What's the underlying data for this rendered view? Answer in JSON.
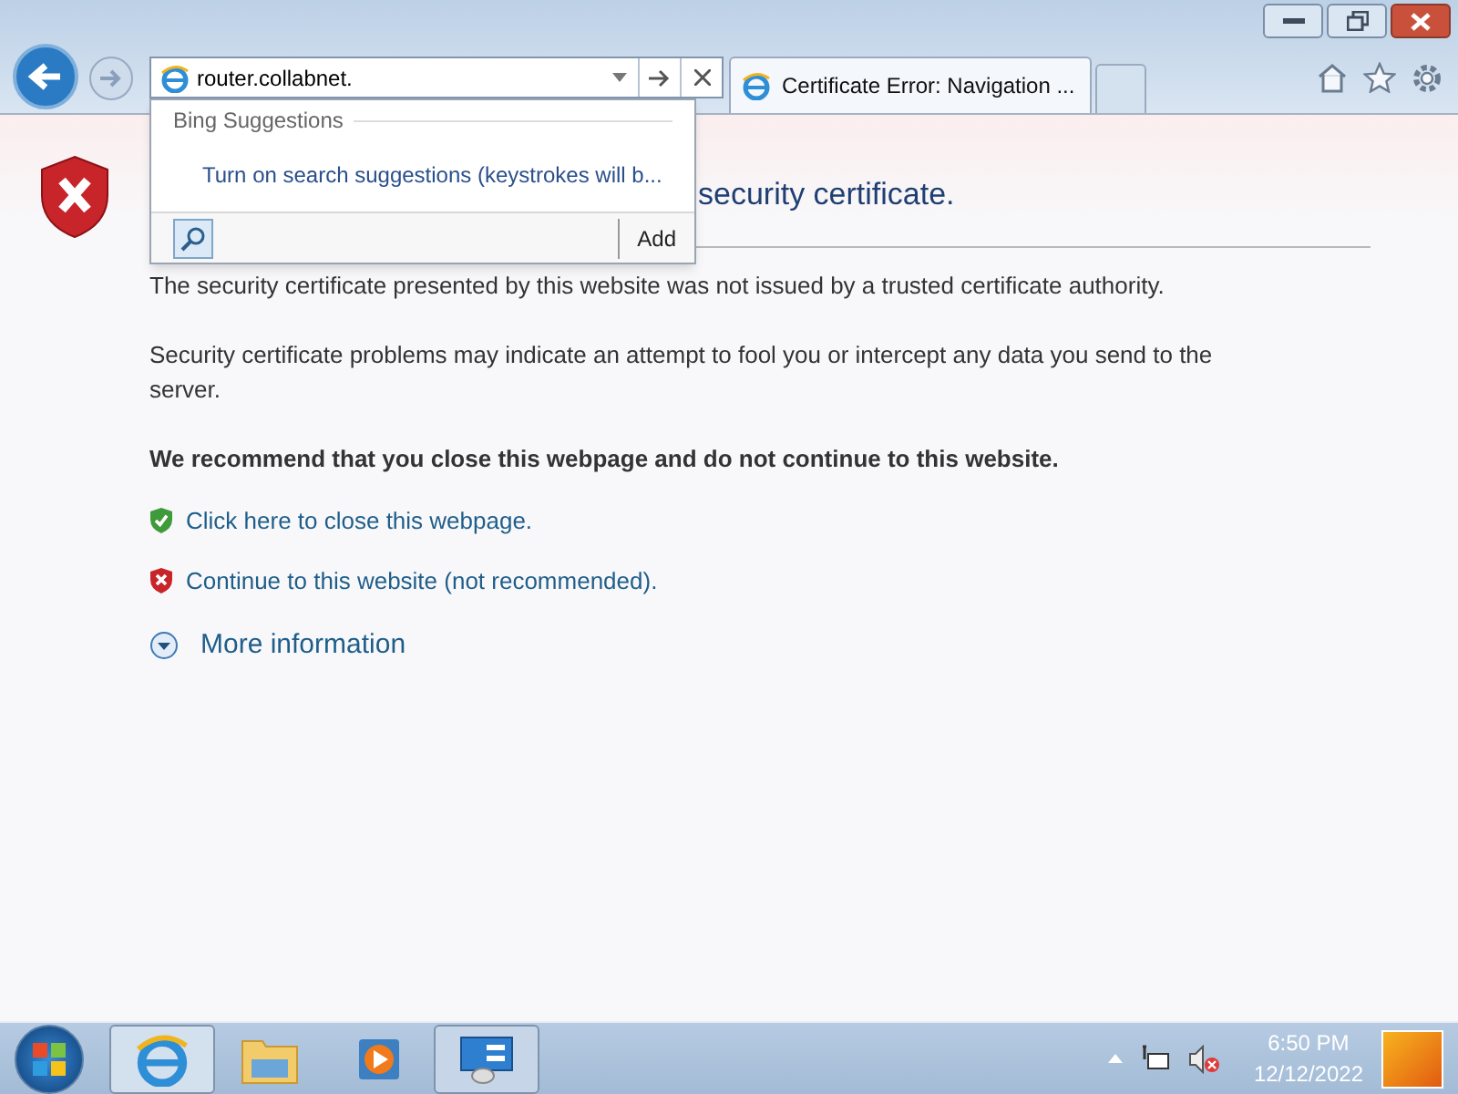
{
  "address_bar": {
    "value": "router.collabnet."
  },
  "tabs": [
    {
      "label": "Certificate Error: Navigation ...",
      "selected": true
    }
  ],
  "suggestions": {
    "header": "Bing Suggestions",
    "item": "Turn on search suggestions (keystrokes will b...",
    "add_label": "Add"
  },
  "page": {
    "heading": "security certificate.",
    "paragraphs": [
      "The security certificate presented by this website was not issued by a trusted certificate authority.",
      "Security certificate problems may indicate an attempt to fool you or intercept any data you send to the server."
    ],
    "recommendation": "We recommend that you close this webpage and do not continue to this website.",
    "links": [
      {
        "kind": "safe",
        "label": "Click here to close this webpage."
      },
      {
        "kind": "unsafe",
        "label": "Continue to this website (not recommended)."
      }
    ],
    "more_info": "More information"
  },
  "taskbar": {
    "time": "6:50 PM",
    "date": "12/12/2022"
  }
}
